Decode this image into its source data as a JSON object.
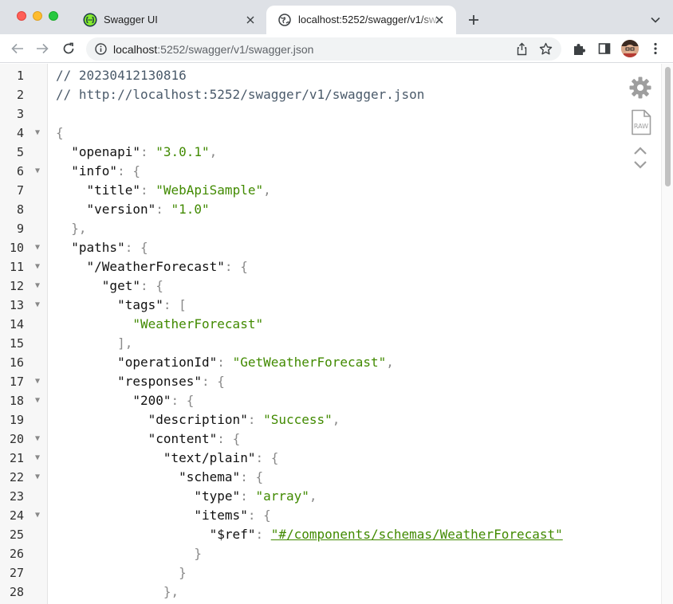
{
  "browser": {
    "tabs": [
      {
        "title": "Swagger UI",
        "active": false,
        "favicon": "swagger-icon"
      },
      {
        "title": "localhost:5252/swagger/v1/swagger.json",
        "active": true,
        "favicon": "globe-icon"
      }
    ],
    "address_bar": {
      "host": "localhost",
      "rest": ":5252/swagger/v1/swagger.json"
    }
  },
  "viewer": {
    "tools": {
      "raw_label": "RAW"
    }
  },
  "lines": [
    {
      "n": "1",
      "fold": false,
      "t": [
        [
          "c",
          "// 20230412130816"
        ]
      ]
    },
    {
      "n": "2",
      "fold": false,
      "t": [
        [
          "c",
          "// http://localhost:5252/swagger/v1/swagger.json"
        ]
      ]
    },
    {
      "n": "3",
      "fold": false,
      "t": []
    },
    {
      "n": "4",
      "fold": true,
      "t": [
        [
          "p",
          "{"
        ]
      ]
    },
    {
      "n": "5",
      "fold": false,
      "t": [
        [
          "i",
          "  "
        ],
        [
          "k",
          "\"openapi\""
        ],
        [
          "p",
          ": "
        ],
        [
          "s",
          "\"3.0.1\""
        ],
        [
          "p",
          ","
        ]
      ]
    },
    {
      "n": "6",
      "fold": true,
      "t": [
        [
          "i",
          "  "
        ],
        [
          "k",
          "\"info\""
        ],
        [
          "p",
          ": {"
        ]
      ]
    },
    {
      "n": "7",
      "fold": false,
      "t": [
        [
          "i",
          "    "
        ],
        [
          "k",
          "\"title\""
        ],
        [
          "p",
          ": "
        ],
        [
          "s",
          "\"WebApiSample\""
        ],
        [
          "p",
          ","
        ]
      ]
    },
    {
      "n": "8",
      "fold": false,
      "t": [
        [
          "i",
          "    "
        ],
        [
          "k",
          "\"version\""
        ],
        [
          "p",
          ": "
        ],
        [
          "s",
          "\"1.0\""
        ]
      ]
    },
    {
      "n": "9",
      "fold": false,
      "t": [
        [
          "i",
          "  "
        ],
        [
          "p",
          "},"
        ]
      ]
    },
    {
      "n": "10",
      "fold": true,
      "t": [
        [
          "i",
          "  "
        ],
        [
          "k",
          "\"paths\""
        ],
        [
          "p",
          ": {"
        ]
      ]
    },
    {
      "n": "11",
      "fold": true,
      "t": [
        [
          "i",
          "    "
        ],
        [
          "k",
          "\"/WeatherForecast\""
        ],
        [
          "p",
          ": {"
        ]
      ]
    },
    {
      "n": "12",
      "fold": true,
      "t": [
        [
          "i",
          "      "
        ],
        [
          "k",
          "\"get\""
        ],
        [
          "p",
          ": {"
        ]
      ]
    },
    {
      "n": "13",
      "fold": true,
      "t": [
        [
          "i",
          "        "
        ],
        [
          "k",
          "\"tags\""
        ],
        [
          "p",
          ": ["
        ]
      ]
    },
    {
      "n": "14",
      "fold": false,
      "t": [
        [
          "i",
          "          "
        ],
        [
          "s",
          "\"WeatherForecast\""
        ]
      ]
    },
    {
      "n": "15",
      "fold": false,
      "t": [
        [
          "i",
          "        "
        ],
        [
          "p",
          "],"
        ]
      ]
    },
    {
      "n": "16",
      "fold": false,
      "t": [
        [
          "i",
          "        "
        ],
        [
          "k",
          "\"operationId\""
        ],
        [
          "p",
          ": "
        ],
        [
          "s",
          "\"GetWeatherForecast\""
        ],
        [
          "p",
          ","
        ]
      ]
    },
    {
      "n": "17",
      "fold": true,
      "t": [
        [
          "i",
          "        "
        ],
        [
          "k",
          "\"responses\""
        ],
        [
          "p",
          ": {"
        ]
      ]
    },
    {
      "n": "18",
      "fold": true,
      "t": [
        [
          "i",
          "          "
        ],
        [
          "k",
          "\"200\""
        ],
        [
          "p",
          ": {"
        ]
      ]
    },
    {
      "n": "19",
      "fold": false,
      "t": [
        [
          "i",
          "            "
        ],
        [
          "k",
          "\"description\""
        ],
        [
          "p",
          ": "
        ],
        [
          "s",
          "\"Success\""
        ],
        [
          "p",
          ","
        ]
      ]
    },
    {
      "n": "20",
      "fold": true,
      "t": [
        [
          "i",
          "            "
        ],
        [
          "k",
          "\"content\""
        ],
        [
          "p",
          ": {"
        ]
      ]
    },
    {
      "n": "21",
      "fold": true,
      "t": [
        [
          "i",
          "              "
        ],
        [
          "k",
          "\"text/plain\""
        ],
        [
          "p",
          ": {"
        ]
      ]
    },
    {
      "n": "22",
      "fold": true,
      "t": [
        [
          "i",
          "                "
        ],
        [
          "k",
          "\"schema\""
        ],
        [
          "p",
          ": {"
        ]
      ]
    },
    {
      "n": "23",
      "fold": false,
      "t": [
        [
          "i",
          "                  "
        ],
        [
          "k",
          "\"type\""
        ],
        [
          "p",
          ": "
        ],
        [
          "s",
          "\"array\""
        ],
        [
          "p",
          ","
        ]
      ]
    },
    {
      "n": "24",
      "fold": true,
      "t": [
        [
          "i",
          "                  "
        ],
        [
          "k",
          "\"items\""
        ],
        [
          "p",
          ": {"
        ]
      ]
    },
    {
      "n": "25",
      "fold": false,
      "t": [
        [
          "i",
          "                    "
        ],
        [
          "k",
          "\"$ref\""
        ],
        [
          "p",
          ": "
        ],
        [
          "lnk",
          "\"#/components/schemas/WeatherForecast\""
        ]
      ]
    },
    {
      "n": "26",
      "fold": false,
      "t": [
        [
          "i",
          "                  "
        ],
        [
          "p",
          "}"
        ]
      ]
    },
    {
      "n": "27",
      "fold": false,
      "t": [
        [
          "i",
          "                "
        ],
        [
          "p",
          "}"
        ]
      ]
    },
    {
      "n": "28",
      "fold": false,
      "t": [
        [
          "i",
          "              "
        ],
        [
          "p",
          "},"
        ]
      ]
    }
  ]
}
